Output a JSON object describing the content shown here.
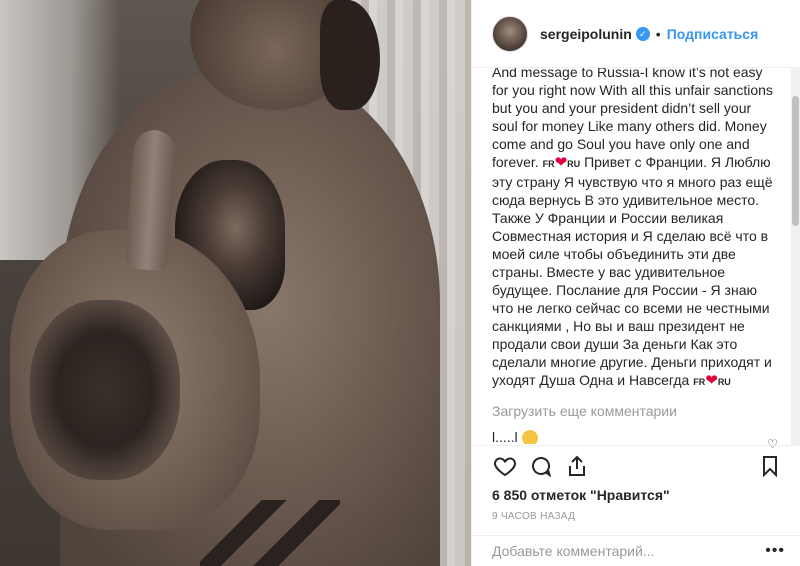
{
  "post": {
    "username": "sergeipolunin",
    "follow_label": "Подписаться",
    "caption_part1": "And message to Russia-I know it’s not easy for you right now With all this unfair sanctions but you and your president didn’t sell your soul for money Like many others did. Money come and go Soul you have only one and forever.",
    "flag_pre": "FR",
    "flag_post": "RU",
    "caption_part2": "Привет с Франции. Я Люблю эту страну Я чувствую что я много раз ещё сюда вернусь В это удивительное место. Также У Франции и России великая Совместная история и Я сделаю всё что в моей силе чтобы объединить эти две страны. Вместе у вас удивительное будущее. Послание для России - Я знаю что не легко сейчас со всеми не честными санкциями , Но вы и ваш президент не продали свои души За деньги Как это сделали многие другие. Деньги приходят и уходят Душа Одна и Навсегда",
    "load_more_label": "Загрузить еще комментарии",
    "next_comment_text": "l.....l",
    "likes_text": "6 850 отметок \"Нравится\"",
    "time_text": "9 ЧАСОВ НАЗАД",
    "add_comment_placeholder": "Добавьте комментарий...",
    "more_options": "•••"
  },
  "icons": {
    "verified": "verified-badge-icon",
    "like": "heart-outline-icon",
    "comment": "comment-bubble-icon",
    "share": "share-upload-icon",
    "save": "bookmark-icon"
  },
  "colors": {
    "accent": "#3897f0",
    "heart": "#e0003b",
    "muted": "#999999",
    "text": "#262626"
  }
}
